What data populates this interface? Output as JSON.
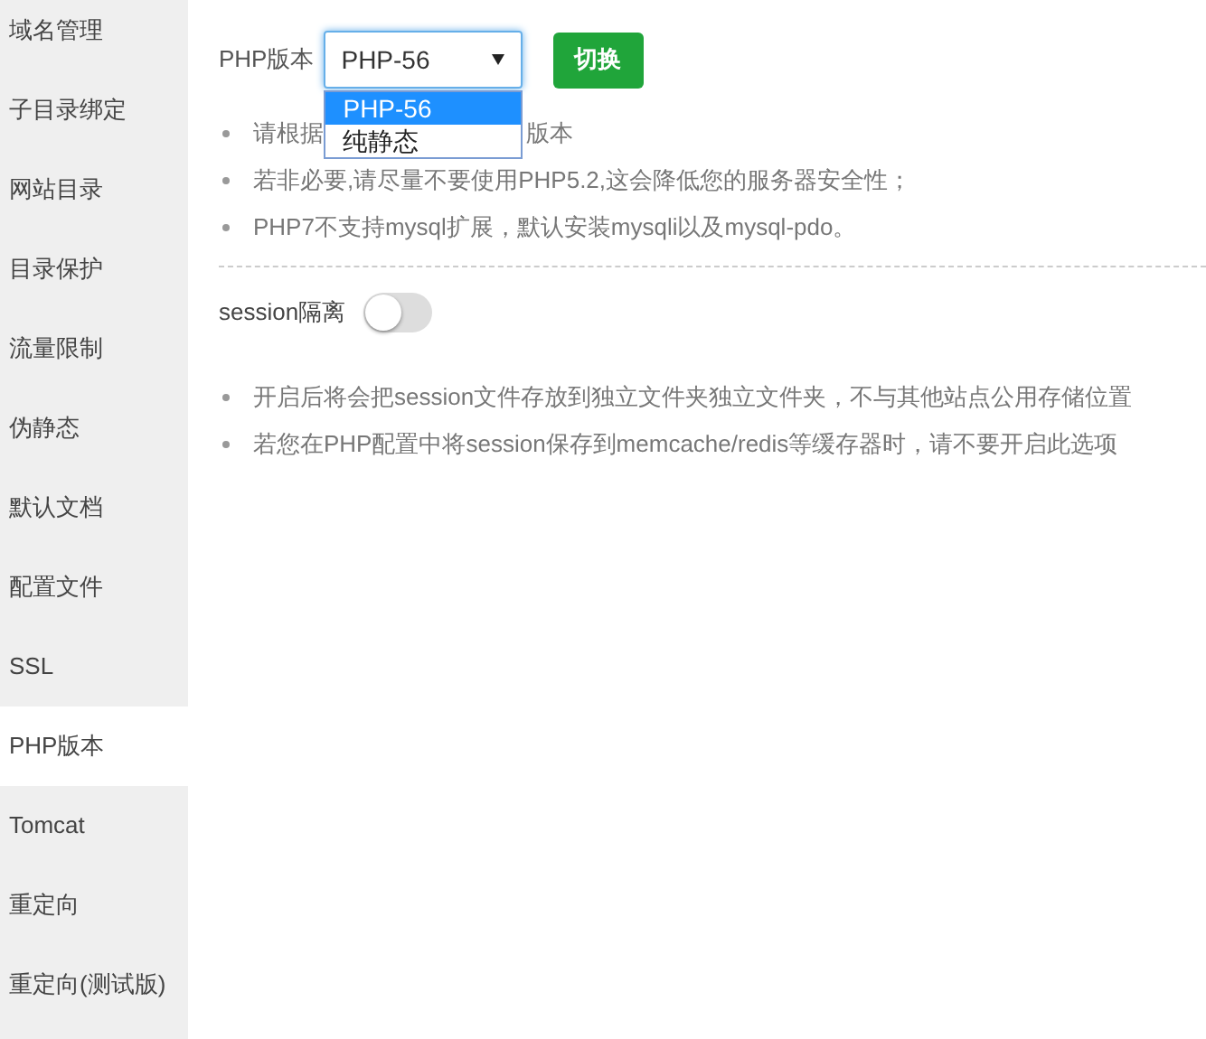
{
  "sidebar": {
    "items": [
      {
        "label": "域名管理",
        "selected": false
      },
      {
        "label": "子目录绑定",
        "selected": false
      },
      {
        "label": "网站目录",
        "selected": false
      },
      {
        "label": "目录保护",
        "selected": false
      },
      {
        "label": "流量限制",
        "selected": false
      },
      {
        "label": "伪静态",
        "selected": false
      },
      {
        "label": "默认文档",
        "selected": false
      },
      {
        "label": "配置文件",
        "selected": false
      },
      {
        "label": "SSL",
        "selected": false
      },
      {
        "label": "PHP版本",
        "selected": true
      },
      {
        "label": "Tomcat",
        "selected": false
      },
      {
        "label": "重定向",
        "selected": false
      },
      {
        "label": "重定向(测试版)",
        "selected": false
      }
    ]
  },
  "php": {
    "label": "PHP版本",
    "select": {
      "value": "PHP-56",
      "expanded": true,
      "options": [
        {
          "label": "PHP-56",
          "selected": true
        },
        {
          "label": "纯静态",
          "selected": false
        }
      ]
    },
    "button": "切换",
    "notes": [
      {
        "kind": "split",
        "start": "请根据",
        "end": "版本"
      },
      {
        "kind": "text",
        "text": "若非必要,请尽量不要使用PHP5.2,这会降低您的服务器安全性；"
      },
      {
        "kind": "text",
        "text": "PHP7不支持mysql扩展，默认安装mysqli以及mysql-pdo。"
      }
    ]
  },
  "session": {
    "label": "session隔离",
    "on": false,
    "notes": [
      "开启后将会把session文件存放到独立文件夹独立文件夹，不与其他站点公用存储位置",
      "若您在PHP配置中将session保存到memcache/redis等缓存器时，请不要开启此选项"
    ]
  }
}
